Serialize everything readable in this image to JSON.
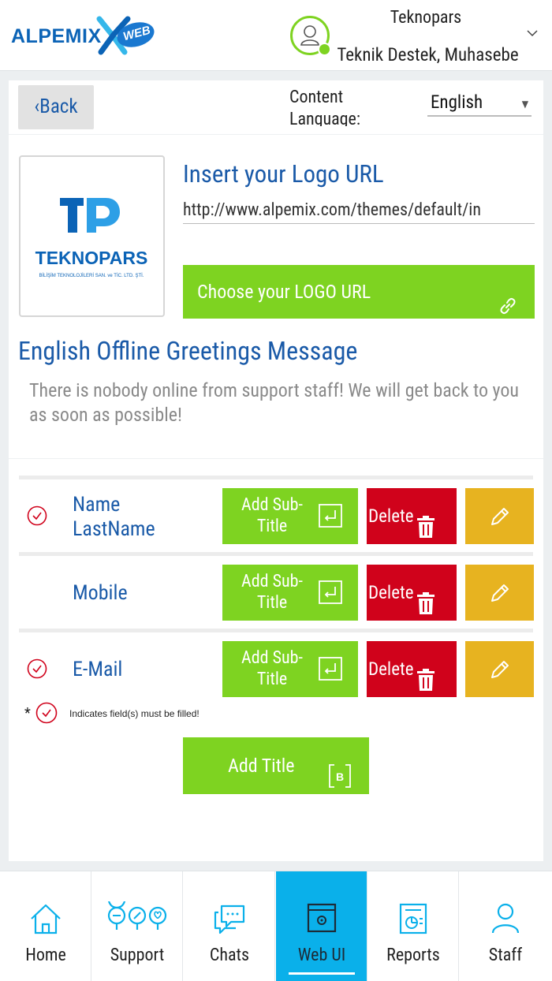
{
  "header": {
    "logo_text": "ALPEMIX",
    "logo_badge": "WEB",
    "user_name": "Teknopars",
    "user_roles": "Teknik Destek, Muhasebe",
    "chevron": "chevron-down-icon"
  },
  "toolbar": {
    "back_label": "‹Back",
    "content_language_label": "Content Language:",
    "language_value": "English"
  },
  "logo_section": {
    "company_logo_text": "TEKNOPARS",
    "company_logo_sub": "BİLİŞİM TEKNOLOJİLERİ SAN. ve TİC. LTD. ŞTİ.",
    "company_monogram": "TP",
    "title": "Insert your Logo URL",
    "url_value": "http://www.alpemix.com/themes/default/in",
    "choose_button_label": "Choose your LOGO URL"
  },
  "greetings": {
    "title": "English Offline Greetings Message",
    "message": "There is nobody online from support staff! We will get back to you as soon as possible!"
  },
  "fields": [
    {
      "label": "Name LastName",
      "required": true,
      "add_subtitle_label": "Add Sub-Title",
      "delete_label": "Delete"
    },
    {
      "label": "Mobile",
      "required": false,
      "add_subtitle_label": "Add Sub-Title",
      "delete_label": "Delete"
    },
    {
      "label": "E-Mail",
      "required": true,
      "add_subtitle_label": "Add Sub-Title",
      "delete_label": "Delete"
    }
  ],
  "required_note": {
    "star": "*",
    "text": "Indicates field(s) must be filled!"
  },
  "add_title_label": "Add Title",
  "nav": {
    "items": [
      {
        "label": "Home",
        "icon": "home-icon",
        "active": false
      },
      {
        "label": "Support",
        "icon": "support-icon",
        "active": false
      },
      {
        "label": "Chats",
        "icon": "chats-icon",
        "active": false
      },
      {
        "label": "Web UI",
        "icon": "web-ui-icon",
        "active": true
      },
      {
        "label": "Reports",
        "icon": "reports-icon",
        "active": false
      },
      {
        "label": "Staff",
        "icon": "staff-icon",
        "active": false
      }
    ]
  },
  "colors": {
    "brand_blue": "#1a5aa8",
    "green": "#7ed321",
    "red": "#d0021b",
    "yellow": "#e7b320",
    "nav_active": "#0ab0ea"
  }
}
